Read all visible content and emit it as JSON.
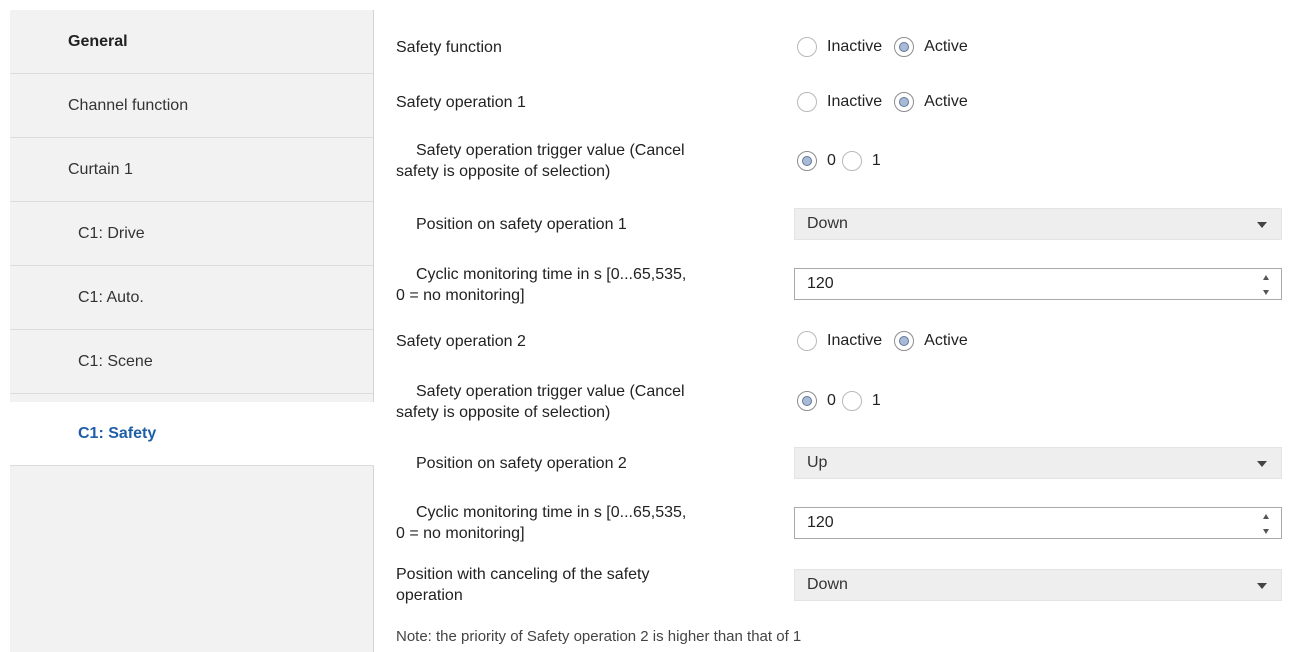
{
  "sidebar": {
    "items": [
      {
        "label": "General"
      },
      {
        "label": "Channel function"
      },
      {
        "label": "Curtain 1"
      },
      {
        "label": "C1: Drive"
      },
      {
        "label": "C1: Auto."
      },
      {
        "label": "C1: Scene"
      },
      {
        "label": "C1: Safety"
      }
    ]
  },
  "params": {
    "safety_function": {
      "label": "Safety function",
      "opt1": "Inactive",
      "opt2": "Active",
      "selected": "Active"
    },
    "safety_op1": {
      "label": "Safety operation 1",
      "opt1": "Inactive",
      "opt2": "Active",
      "selected": "Active"
    },
    "trigger1": {
      "label_line1": "Safety operation trigger value (Cancel",
      "label_line2": "safety is opposite of  selection)",
      "opt1": "0",
      "opt2": "1",
      "selected": "0"
    },
    "position1": {
      "label": "Position on safety operation 1",
      "value": "Down"
    },
    "cyclic1": {
      "label_line1": "Cyclic monitoring time in s [0...65,535,",
      "label_line2": "0 = no monitoring]",
      "value": "120"
    },
    "safety_op2": {
      "label": "Safety operation 2",
      "opt1": "Inactive",
      "opt2": "Active",
      "selected": "Active"
    },
    "trigger2": {
      "label_line1": "Safety operation trigger value (Cancel",
      "label_line2": "safety is opposite of  selection)",
      "opt1": "0",
      "opt2": "1",
      "selected": "0"
    },
    "position2": {
      "label": "Position on safety operation 2",
      "value": "Up"
    },
    "cyclic2": {
      "label_line1": "Cyclic monitoring time in s [0...65,535,",
      "label_line2": "0 = no monitoring]",
      "value": "120"
    },
    "cancel_pos": {
      "label_line1": "Position with canceling of the safety",
      "label_line2": "operation",
      "value": "Down"
    }
  },
  "note": "Note: the priority of Safety operation 2 is higher than that of 1",
  "colors": {
    "accent": "#1f5fa8",
    "sidebar_bg": "#f2f2f2",
    "select_bg": "#eeeeee"
  }
}
